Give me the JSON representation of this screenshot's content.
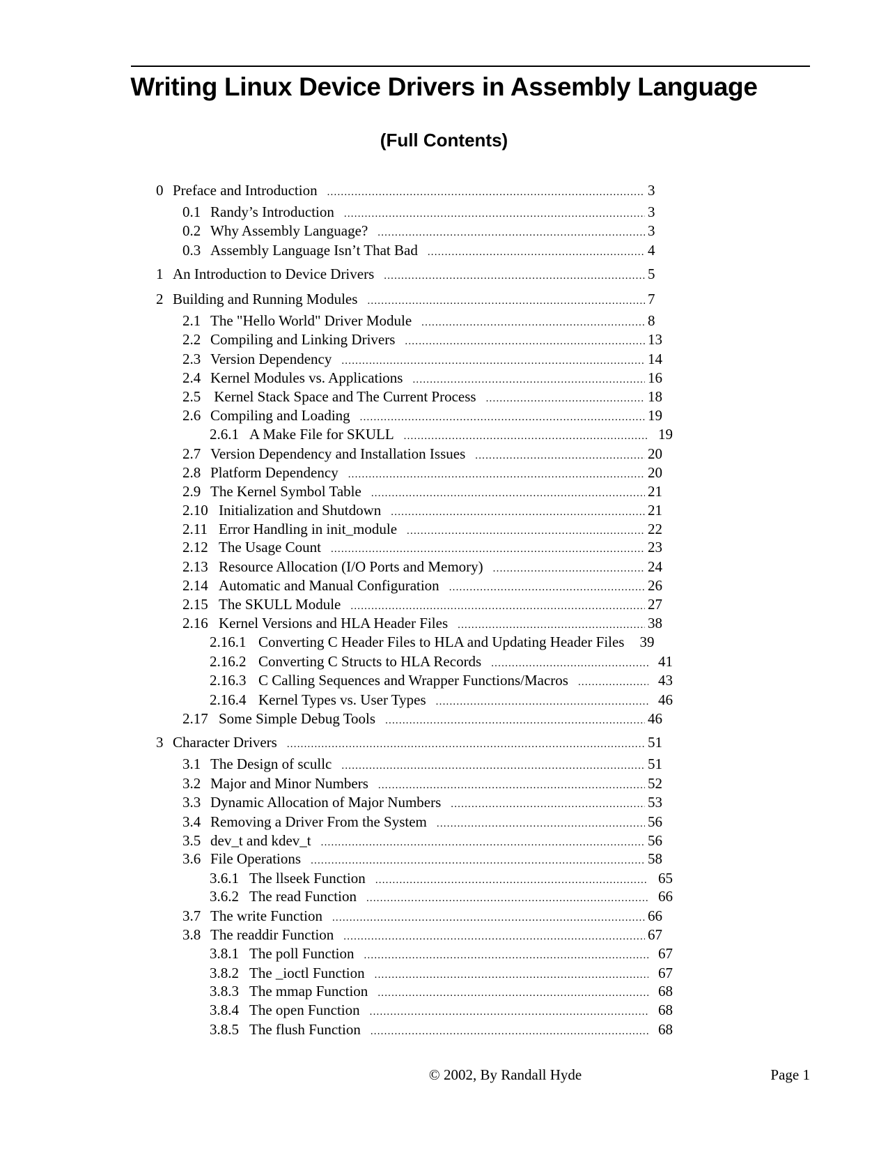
{
  "document": {
    "title": "Writing Linux Device Drivers in Assembly Language",
    "subtitle": "(Full Contents)"
  },
  "toc": [
    {
      "level": 0,
      "num": "0",
      "title": "Preface and Introduction",
      "page": "3"
    },
    {
      "level": 1,
      "num": "0.1",
      "title": "Randy’s Introduction",
      "page": "3"
    },
    {
      "level": 1,
      "num": "0.2",
      "title": "Why Assembly Language?",
      "page": "3"
    },
    {
      "level": 1,
      "num": "0.3",
      "title": "Assembly Language Isn’t That Bad",
      "page": "4"
    },
    {
      "level": 0,
      "num": "1",
      "title": "An Introduction to Device Drivers",
      "page": "5"
    },
    {
      "level": 0,
      "num": "2",
      "title": "Building and Running Modules",
      "page": "7"
    },
    {
      "level": 1,
      "num": "2.1",
      "title": "The \"Hello World\" Driver Module",
      "page": "8"
    },
    {
      "level": 1,
      "num": "2.2",
      "title": "Compiling and Linking Drivers",
      "page": "13"
    },
    {
      "level": 1,
      "num": "2.3",
      "title": "Version Dependency",
      "page": "14"
    },
    {
      "level": 1,
      "num": "2.4",
      "title": "Kernel Modules vs. Applications",
      "page": "16"
    },
    {
      "level": 1,
      "num": "2.5",
      "title": " Kernel Stack Space and The Current Process",
      "page": "18"
    },
    {
      "level": 1,
      "num": "2.6",
      "title": "Compiling and Loading",
      "page": "19"
    },
    {
      "level": 2,
      "num": "2.6.1",
      "title": "A Make File for SKULL",
      "page": "19"
    },
    {
      "level": 1,
      "num": "2.7",
      "title": "Version Dependency and Installation Issues",
      "page": "20"
    },
    {
      "level": 1,
      "num": "2.8",
      "title": "Platform Dependency",
      "page": "20"
    },
    {
      "level": 1,
      "num": "2.9",
      "title": "The Kernel Symbol Table",
      "page": "21"
    },
    {
      "level": 1,
      "num": "2.10",
      "title": "Initialization and Shutdown",
      "page": "21"
    },
    {
      "level": 1,
      "num": "2.11",
      "title": "Error Handling in init_module",
      "page": "22"
    },
    {
      "level": 1,
      "num": "2.12",
      "title": "The Usage Count",
      "page": "23"
    },
    {
      "level": 1,
      "num": "2.13",
      "title": "Resource Allocation (I/O Ports and Memory)",
      "page": "24"
    },
    {
      "level": 1,
      "num": "2.14",
      "title": "Automatic and Manual Configuration",
      "page": "26"
    },
    {
      "level": 1,
      "num": "2.15",
      "title": "The SKULL Module",
      "page": "27"
    },
    {
      "level": 1,
      "num": "2.16",
      "title": "Kernel Versions and HLA Header Files",
      "page": "38"
    },
    {
      "level": 2,
      "num": "2.16.1",
      "title": "Converting C Header Files to HLA and Updating Header Files",
      "page": "39",
      "noleader": true
    },
    {
      "level": 2,
      "num": "2.16.2",
      "title": "Converting C Structs to HLA Records",
      "page": "41"
    },
    {
      "level": 2,
      "num": "2.16.3",
      "title": "C Calling Sequences and Wrapper Functions/Macros",
      "page": "43"
    },
    {
      "level": 2,
      "num": "2.16.4",
      "title": "Kernel Types vs. User Types",
      "page": "46"
    },
    {
      "level": 1,
      "num": "2.17",
      "title": "Some Simple Debug Tools",
      "page": "46"
    },
    {
      "level": 0,
      "num": "3",
      "title": "Character Drivers",
      "page": "51"
    },
    {
      "level": 1,
      "num": "3.1",
      "title": "The Design of scullc",
      "page": "51"
    },
    {
      "level": 1,
      "num": "3.2",
      "title": "Major and Minor Numbers",
      "page": "52"
    },
    {
      "level": 1,
      "num": "3.3",
      "title": "Dynamic Allocation of Major Numbers",
      "page": "53"
    },
    {
      "level": 1,
      "num": "3.4",
      "title": "Removing a Driver From the System",
      "page": "56"
    },
    {
      "level": 1,
      "num": "3.5",
      "title": "dev_t and kdev_t",
      "page": "56"
    },
    {
      "level": 1,
      "num": "3.6",
      "title": "File Operations",
      "page": "58"
    },
    {
      "level": 2,
      "num": "3.6.1",
      "title": "The llseek Function",
      "page": "65"
    },
    {
      "level": 2,
      "num": "3.6.2",
      "title": "The read Function",
      "page": "66"
    },
    {
      "level": 1,
      "num": "3.7",
      "title": "The write Function",
      "page": "66"
    },
    {
      "level": 1,
      "num": "3.8",
      "title": "The readdir Function",
      "page": "67"
    },
    {
      "level": 2,
      "num": "3.8.1",
      "title": "The poll Function",
      "page": "67"
    },
    {
      "level": 2,
      "num": "3.8.2",
      "title": "The _ioctl Function",
      "page": "67"
    },
    {
      "level": 2,
      "num": "3.8.3",
      "title": "The mmap Function",
      "page": "68"
    },
    {
      "level": 2,
      "num": "3.8.4",
      "title": "The open Function",
      "page": "68"
    },
    {
      "level": 2,
      "num": "3.8.5",
      "title": "The flush Function",
      "page": "68"
    }
  ],
  "footer": {
    "copyright": "© 2002, By Randall Hyde",
    "page_label": "Page 1"
  }
}
